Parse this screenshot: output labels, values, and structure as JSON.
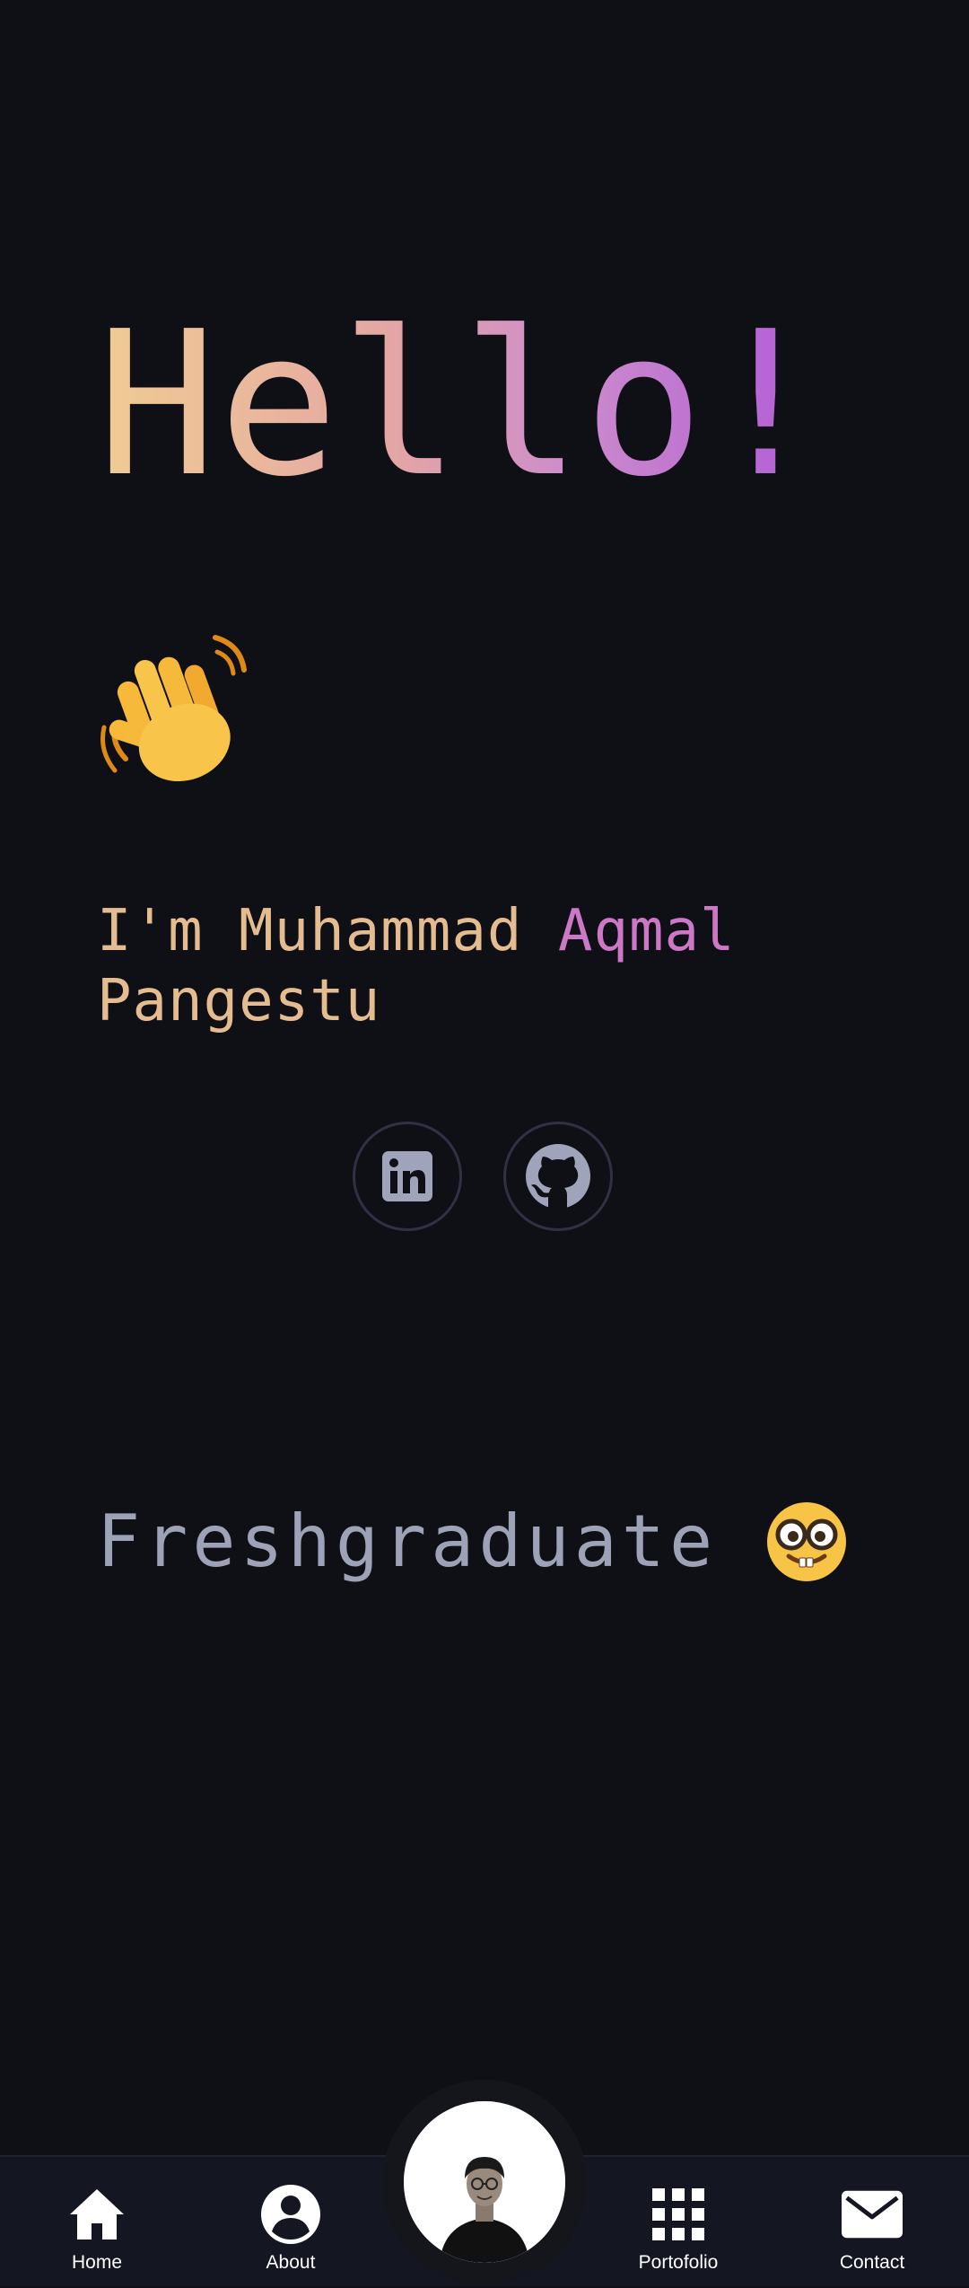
{
  "hero": {
    "greeting": "Hello!",
    "intro_prefix": "I'm Muhammad ",
    "intro_highlight": "Aqmal",
    "intro_last": "Pangestu",
    "role": "Freshgraduate"
  },
  "socials": [
    {
      "name": "LinkedIn",
      "icon": "linkedin-icon"
    },
    {
      "name": "GitHub",
      "icon": "github-icon"
    }
  ],
  "nav": {
    "home": {
      "label": "Home",
      "icon": "home-icon"
    },
    "about": {
      "label": "About",
      "icon": "user-circle-icon"
    },
    "portfolio": {
      "label": "Portofolio",
      "icon": "grid-icon"
    },
    "contact": {
      "label": "Contact",
      "icon": "mail-icon"
    }
  },
  "colors": {
    "background": "#0f1016",
    "navbar": "#141621",
    "gradient_start": "#f0cc94",
    "gradient_end": "#b05ad6",
    "intro": "#e5bc90",
    "intro_highlight": "#cc78c6",
    "role_text": "#9ea2b6",
    "social_icon": "#a0a4ba"
  }
}
